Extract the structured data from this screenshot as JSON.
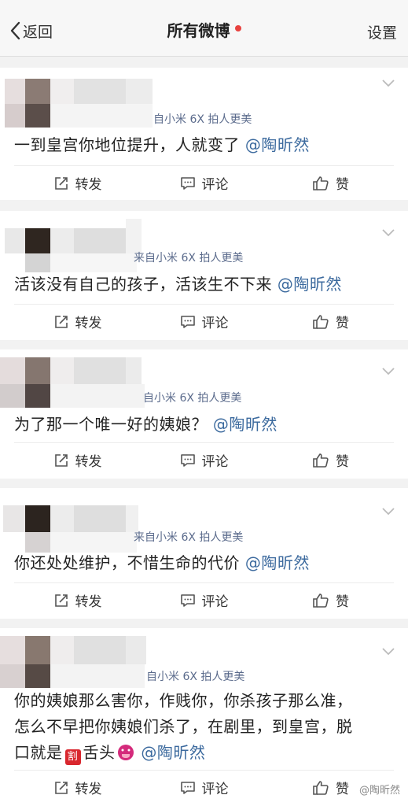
{
  "header": {
    "back_label": "返回",
    "title": "所有微博",
    "settings_label": "设置"
  },
  "posts": [
    {
      "source": "自小米 6X 拍人更美",
      "text": "一到皇宫你地位提升，人就变了",
      "mention": "@陶昕然"
    },
    {
      "source": "来自小米 6X 拍人更美",
      "text": "活该没有自己的孩子，活该生不下来",
      "mention": "@陶昕然"
    },
    {
      "source": "自小米 6X 拍人更美",
      "text": "为了那一个唯一好的姨娘？",
      "mention": "@陶昕然"
    },
    {
      "source": "来自小米 6X 拍人更美",
      "text": "你还处处维护，不惜生命的代价",
      "mention": "@陶昕然"
    },
    {
      "source": "自小米 6X 拍人更美",
      "line1": "你的姨娘那么害你，作贱你，你杀孩子那么准，",
      "line2": "怎么不早把你姨娘们杀了，在剧里，到皇宫，脱",
      "line3_start": "口就是",
      "emoji_cut": "割",
      "line3_mid": "舌头",
      "mention": "@陶昕然"
    }
  ],
  "actions": {
    "repost": "转发",
    "comment": "评论",
    "like": "赞"
  },
  "watermark": "@陶昕然"
}
